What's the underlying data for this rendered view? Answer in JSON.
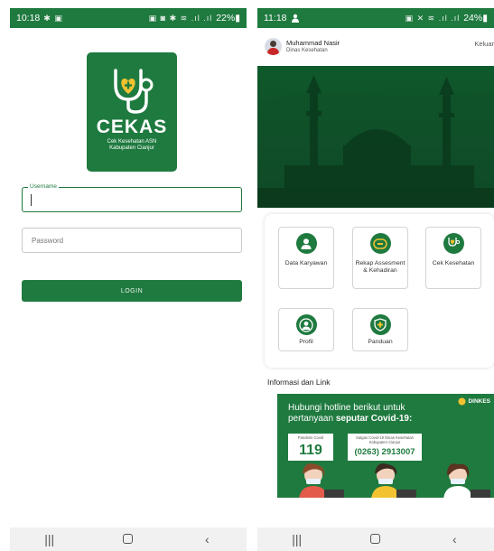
{
  "login_screen": {
    "status_bar": {
      "time": "10:18",
      "left_icons": "✱ ▣",
      "right_icons": "▣ ◙ ✱ ≋ .ıl .ıl",
      "battery": "22%▮"
    },
    "logo": {
      "title": "CEKAS",
      "subtitle_line1": "Cek Kesehatan ASN",
      "subtitle_line2": "Kabupaten Cianjur",
      "icon": "stethoscope-heart-icon"
    },
    "username": {
      "label": "Username",
      "value": ""
    },
    "password": {
      "placeholder": "Password",
      "value": ""
    },
    "login_button": "LOGIN",
    "nav": {
      "recents": "|||",
      "back": "‹"
    }
  },
  "home_screen": {
    "status_bar": {
      "time": "11:18",
      "right_icons": "▣ ✕ ≋ .ıl .ıl",
      "battery": "24%▮"
    },
    "user": {
      "name": "Muhammad Nasir",
      "role": "Dinas Kesehatan"
    },
    "logout": "Keluar",
    "menu": [
      {
        "label": "Data Karyawan",
        "icon": "person-icon"
      },
      {
        "label": "Rekap Assesment & Kehadiran",
        "icon": "report-icon"
      },
      {
        "label": "Cek Kesehatan",
        "icon": "stethoscope-heart-icon"
      },
      {
        "label": "Profil",
        "icon": "profile-icon"
      },
      {
        "label": "Panduan",
        "icon": "shield-plus-icon"
      }
    ],
    "info_title": "Informasi dan Link",
    "promo": {
      "line1": "Hubungi hotline berikut untuk",
      "line2_prefix": "pertanyaan",
      "line2_bold": "seputar Covid-19:",
      "brand": "DINKES",
      "box1_caption": "Pandemi Covid",
      "box1_number": "119",
      "box2_caption": "Satgas Covid-19 Dinas Kesehatan Kabupaten Cianjur",
      "box2_number": "(0263) 2913007"
    },
    "nav": {
      "recents": "|||",
      "back": "‹"
    }
  },
  "colors": {
    "primary": "#1f7a3f",
    "background": "#ffffff"
  }
}
